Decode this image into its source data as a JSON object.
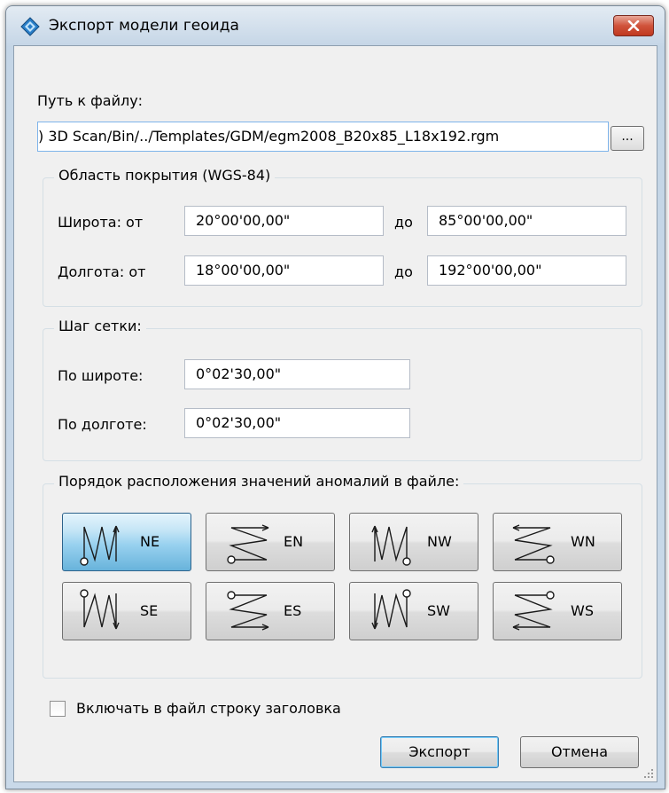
{
  "window": {
    "title": "Экспорт модели геоида",
    "close_icon": "close-icon"
  },
  "file": {
    "label": "Путь к файлу:",
    "path": ") 3D Scan/Bin/../Templates/GDM/egm2008_B20x85_L18x192.rgm",
    "browse_label": "..."
  },
  "coverage": {
    "legend": "Область покрытия (WGS-84)",
    "lat_label": "Широта: от",
    "lat_from": "20°00'00,00\"",
    "lat_to_label": "до",
    "lat_to": "85°00'00,00\"",
    "lon_label": "Долгота: от",
    "lon_from": "18°00'00,00\"",
    "lon_to_label": "до",
    "lon_to": "192°00'00,00\""
  },
  "grid": {
    "legend": "Шаг сетки:",
    "lat_label": "По широте:",
    "lat_step": "0°02'30,00\"",
    "lon_label": "По долготе:",
    "lon_step": "0°02'30,00\""
  },
  "order": {
    "legend": "Порядок расположения значений аномалий в файле:",
    "selected": "NE",
    "buttons": [
      {
        "code": "NE",
        "icon": "zigzag-ne-icon"
      },
      {
        "code": "EN",
        "icon": "zigzag-en-icon"
      },
      {
        "code": "NW",
        "icon": "zigzag-nw-icon"
      },
      {
        "code": "WN",
        "icon": "zigzag-wn-icon"
      },
      {
        "code": "SE",
        "icon": "zigzag-se-icon"
      },
      {
        "code": "ES",
        "icon": "zigzag-es-icon"
      },
      {
        "code": "SW",
        "icon": "zigzag-sw-icon"
      },
      {
        "code": "WS",
        "icon": "zigzag-ws-icon"
      }
    ]
  },
  "header_checkbox": {
    "label": "Включать в файл строку заголовка",
    "checked": false
  },
  "buttons": {
    "export_label": "Экспорт",
    "cancel_label": "Отмена"
  },
  "colors": {
    "selected_button": "#68b3db",
    "close_button": "#c0391f",
    "title_gradient": "#c4d5e6"
  }
}
